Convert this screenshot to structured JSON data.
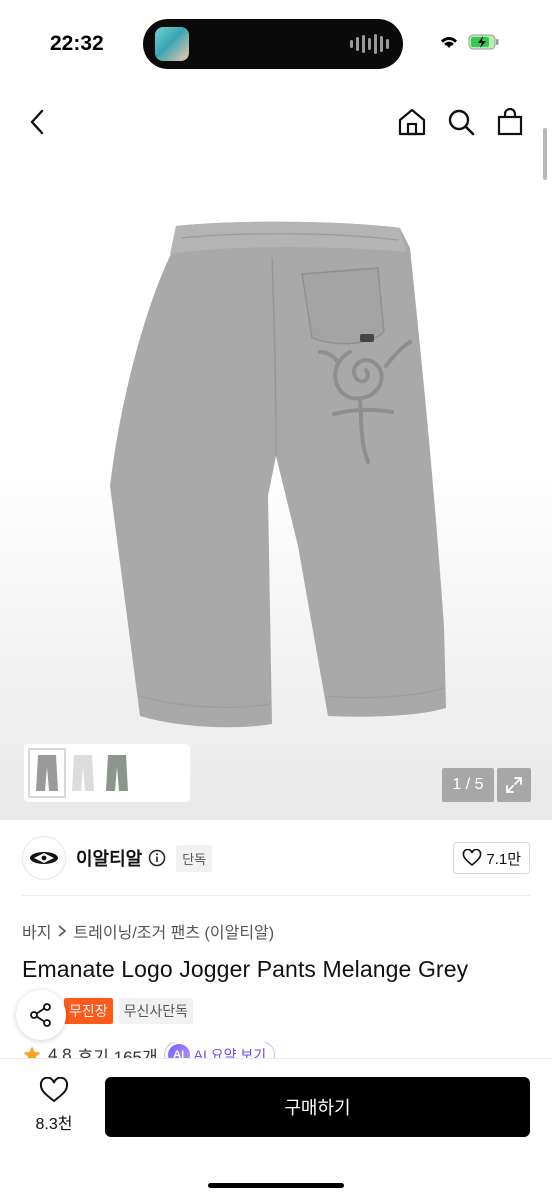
{
  "status_bar": {
    "time": "22:32"
  },
  "gallery": {
    "counter": "1 / 5",
    "thumbnail_colors": [
      "#9a9a9a",
      "#dcdcdc",
      "#8c958c"
    ]
  },
  "brand": {
    "name": "이알티알",
    "exclusive_label": "단독",
    "likes": "7.1만"
  },
  "breadcrumb": {
    "category": "바지",
    "subcategory": "트레이닝/조거 팬츠 (이알티알)"
  },
  "product": {
    "title": "Emanate Logo Jogger Pants Melange Grey",
    "badges": [
      "무진장",
      "무신사단독"
    ],
    "rating": "4.8",
    "reviews": "후기 165개",
    "ai_label": "AI 요약 보기"
  },
  "bottom_bar": {
    "wish_count": "8.3천",
    "buy_label": "구매하기"
  },
  "colors": {
    "accent_orange": "#ff5a1a",
    "star": "#f5a623",
    "ai_purple": "#6b4cf0",
    "buy_button": "#000000"
  }
}
